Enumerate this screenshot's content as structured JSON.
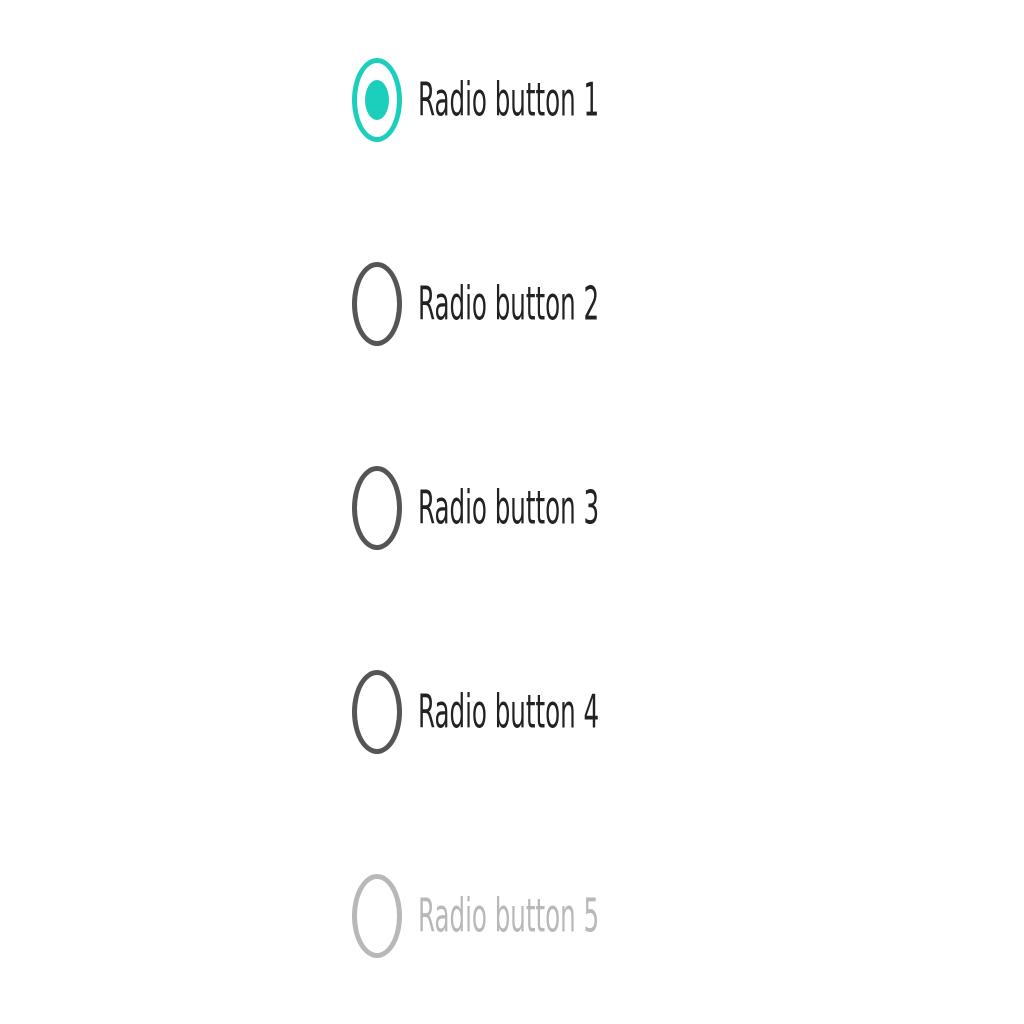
{
  "radio_group": {
    "items": [
      {
        "label": "Radio button 1",
        "selected": true,
        "disabled": false
      },
      {
        "label": "Radio button 2",
        "selected": false,
        "disabled": false
      },
      {
        "label": "Radio button 3",
        "selected": false,
        "disabled": false
      },
      {
        "label": "Radio button 4",
        "selected": false,
        "disabled": false
      },
      {
        "label": "Radio button 5",
        "selected": false,
        "disabled": true
      }
    ]
  },
  "colors": {
    "accent": "#1ccfbd",
    "text": "#222222",
    "border": "#555555",
    "disabled": "#b8b8b8"
  }
}
